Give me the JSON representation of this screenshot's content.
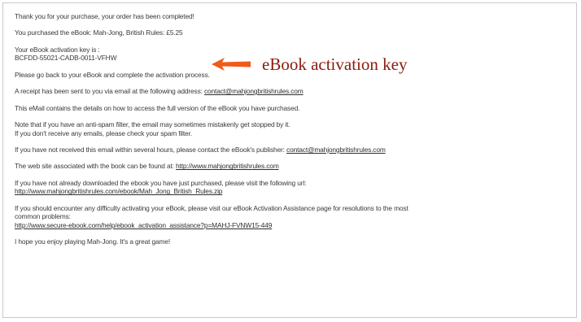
{
  "message": {
    "thank_you": "Thank you for your purchase, your order has been completed!",
    "purchased": "You purchased the eBook: Mah-Jong, British Rules: £5.25",
    "key_label": "Your eBook activation key is :",
    "key_value": "BCFDD-55021-CADB-0011-VFHW",
    "go_back": "Please go back to your eBook and complete the activation process.",
    "receipt_text": "A receipt has been sent to you via email at the following address:",
    "receipt_email": "contact@mahjongbritishrules.com",
    "details": "This eMail contains the details on how to access the full version of the eBook you have purchased.",
    "spam_line1": "Note that if you have an anti-spam filter, the email may sometimes mistakenly get stopped by it.",
    "spam_line2": "If you don't receive any emails, please check your spam filter.",
    "not_received_text": "If you have not received this email within several hours, please contact the eBook's publisher:",
    "publisher_email": "contact@mahjongbritishrules.com",
    "website_text": "The web site associated with the book can be found at:",
    "website_url": "http://www.mahjongbritishrules.com",
    "download_text": "If you have not already downloaded the ebook you have just purchased, please visit the following url:",
    "download_url": "http://www.mahjongbritishrules.com/ebook/Mah_Jong_British_Rules.zip",
    "difficulty_line1": "If you should encounter any difficulty activating your eBook, please visit our eBook Activation Assistance page for resolutions to the most",
    "difficulty_line2": "common problems:",
    "assistance_url": "http://www.secure-ebook.com/help/ebook_activation_assistance?p=MAHJ-FVNW15-449",
    "closing": "I hope you enjoy playing Mah-Jong. It's a great game!"
  },
  "annotation": {
    "label": "eBook activation key",
    "arrow_color": "#f05a1a",
    "label_color": "#8b1a0c"
  }
}
